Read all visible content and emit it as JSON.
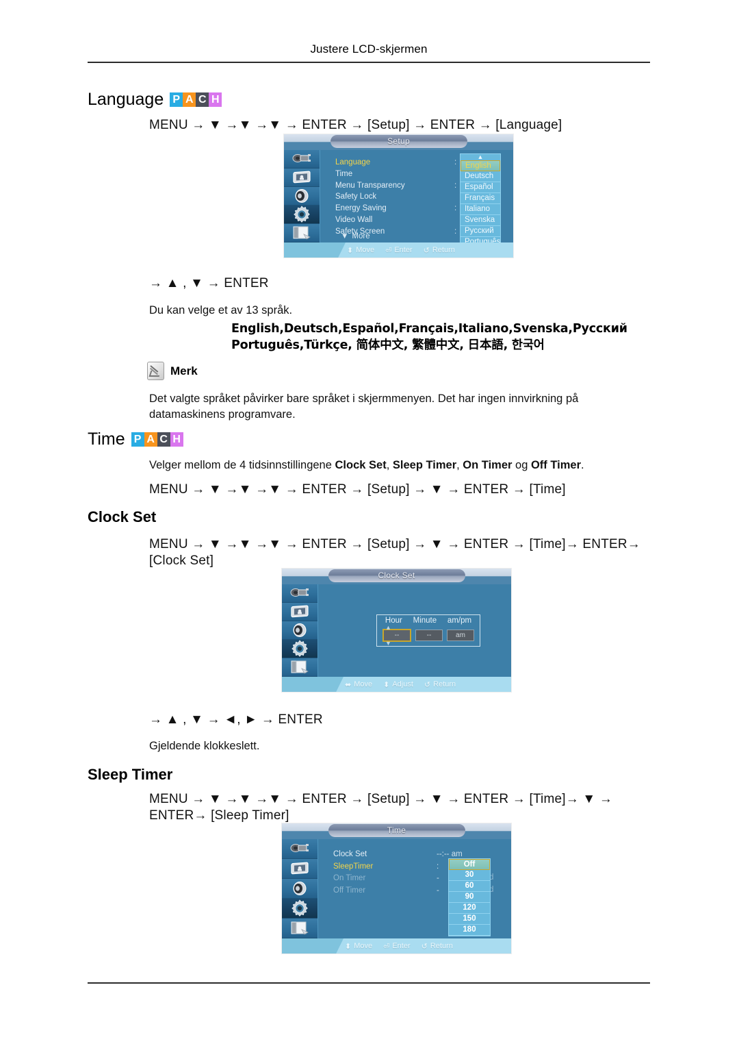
{
  "header": {
    "running_head": "Justere LCD-skjermen"
  },
  "badge": {
    "letters": [
      "P",
      "A",
      "C",
      "H"
    ],
    "colors": [
      "#29ace3",
      "#f7941e",
      "#4c4f5a",
      "#d976ee"
    ]
  },
  "sections": {
    "language": {
      "title": "Language",
      "nav": "MENU → ▼ →▼ →▼ → ENTER → [Setup] → ENTER → [Language]",
      "keys": "→ ▲ , ▼ → ENTER",
      "desc": "Du kan velge et av 13 språk.",
      "langs_line1": "English,Deutsch,Español,Français,Italiano,Svenska,Русский",
      "langs_line2": "Português,Türkçe, 简体中文,  繁體中文, 日本語, 한국어"
    },
    "note": {
      "label": "Merk",
      "text": "Det valgte språket påvirker bare språket i skjermmenyen. Det har ingen innvirkning på datamaskinens programvare."
    },
    "time": {
      "title": "Time",
      "desc_prefix": "Velger mellom de 4 tidsinnstillingene ",
      "desc_b1": "Clock Set",
      "desc_sep1": ", ",
      "desc_b2": "Sleep Timer",
      "desc_sep2": ", ",
      "desc_b3": "On Timer",
      "desc_sep3": " og ",
      "desc_b4": "Off Timer",
      "desc_suffix": ".",
      "nav": "MENU → ▼ →▼ →▼ → ENTER → [Setup] → ▼ → ENTER → [Time]"
    },
    "clock_set": {
      "title": "Clock Set",
      "nav": "MENU → ▼ →▼ →▼ → ENTER → [Setup] → ▼ → ENTER → [Time]→ ENTER→ [Clock Set]",
      "keys": "→ ▲ , ▼ → ◄, ► → ENTER",
      "desc": "Gjeldende klokkeslett."
    },
    "sleep_timer": {
      "title": "Sleep Timer",
      "nav": "MENU → ▼ →▼ →▼ → ENTER → [Setup] → ▼ → ENTER → [Time]→ ▼ → ENTER→ [Sleep Timer]"
    }
  },
  "osd_setup": {
    "title": "Setup",
    "menu_items": [
      "Language",
      "Time",
      "Menu Transparency",
      "Safety Lock",
      "Energy Saving",
      "Video Wall",
      "Safety Screen"
    ],
    "more_label": "More",
    "languages": [
      "English",
      "Deutsch",
      "Español",
      "Français",
      "Italiano",
      "Svenska",
      "Русский",
      "Português"
    ],
    "selected_language": "English",
    "footer": {
      "move": "Move",
      "enter": "Enter",
      "return": "Return"
    }
  },
  "osd_clock": {
    "title": "Clock Set",
    "columns": [
      "Hour",
      "Minute",
      "am/pm"
    ],
    "values": [
      "--",
      "--",
      "am"
    ],
    "selected_index": 0,
    "footer": {
      "move": "Move",
      "adjust": "Adjust",
      "return": "Return"
    }
  },
  "osd_time": {
    "title": "Time",
    "menu_items": [
      "Clock Set",
      "SleepTimer",
      "On Timer",
      "Off Timer"
    ],
    "clock_value": "--:-- am",
    "sleep_options": [
      "Off",
      "30",
      "60",
      "90",
      "120",
      "150",
      "180"
    ],
    "selected_sleep": "Off",
    "footer": {
      "move": "Move",
      "enter": "Enter",
      "return": "Return"
    }
  }
}
